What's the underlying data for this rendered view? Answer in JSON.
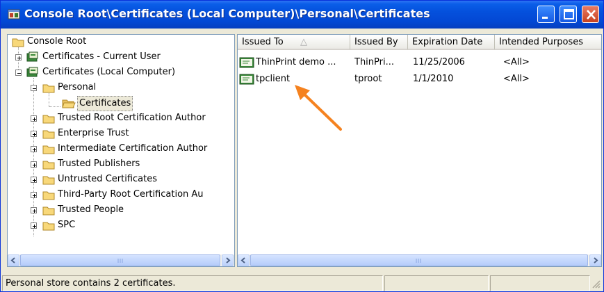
{
  "window": {
    "title": "Console Root\\Certificates (Local Computer)\\Personal\\Certificates"
  },
  "tree": {
    "items": [
      {
        "label": "Console Root"
      },
      {
        "label": "Certificates - Current User"
      },
      {
        "label": "Certificates (Local Computer)"
      },
      {
        "label": "Personal"
      },
      {
        "label": "Certificates"
      },
      {
        "label": "Trusted Root Certification Author"
      },
      {
        "label": "Enterprise Trust"
      },
      {
        "label": "Intermediate Certification Author"
      },
      {
        "label": "Trusted Publishers"
      },
      {
        "label": "Untrusted Certificates"
      },
      {
        "label": "Third-Party Root Certification Au"
      },
      {
        "label": "Trusted People"
      },
      {
        "label": "SPC"
      }
    ]
  },
  "list": {
    "columns": [
      "Issued To",
      "Issued By",
      "Expiration Date",
      "Intended Purposes"
    ],
    "sort_indicator": "△",
    "rows": [
      {
        "issued_to": "ThinPrint demo ...",
        "issued_by": "ThinPri...",
        "expiration": "11/25/2006",
        "purposes": "<All>"
      },
      {
        "issued_to": "tpclient",
        "issued_by": "tproot",
        "expiration": "1/1/2010",
        "purposes": "<All>"
      }
    ]
  },
  "status": {
    "text": "Personal store contains 2 certificates."
  },
  "annotation": {
    "arrow_color": "#f5821f",
    "arrow": "orange-arrow pointing to tpclient"
  },
  "colors": {
    "titlebar": "#0450dc",
    "face": "#ece9d8",
    "folder": "#f8d87a"
  }
}
